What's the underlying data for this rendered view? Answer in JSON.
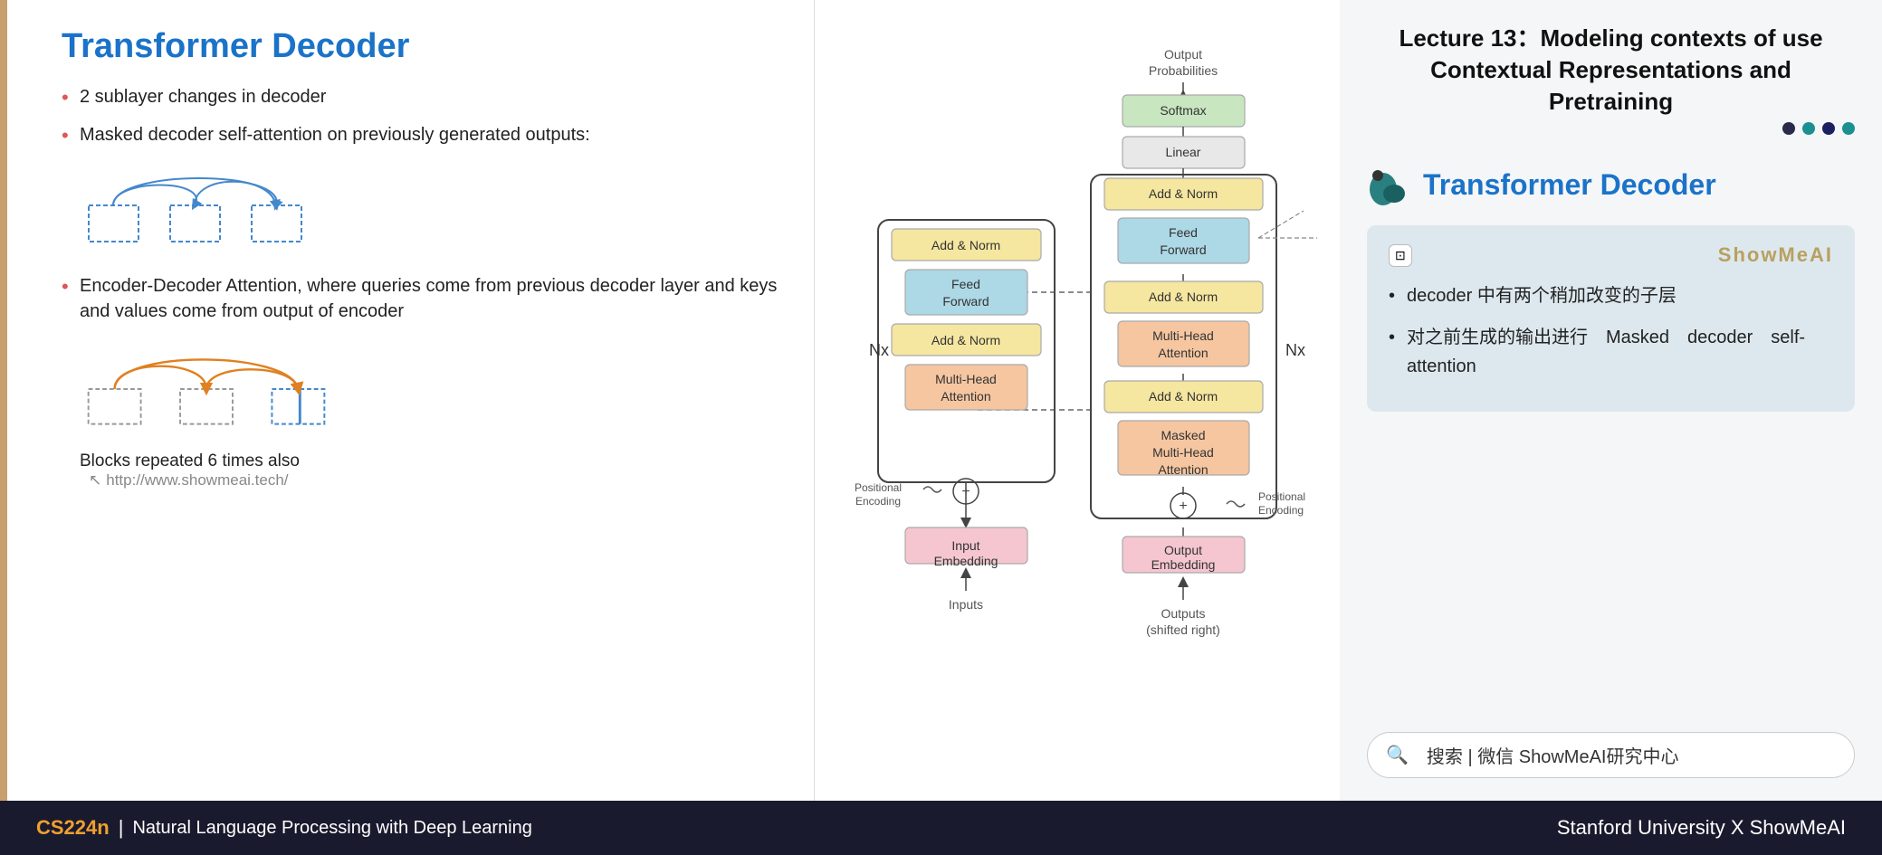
{
  "slide": {
    "title": "Transformer Decoder",
    "bullets": [
      "2 sublayer changes in decoder",
      "Masked decoder self-attention on previously generated outputs:",
      "Encoder-Decoder Attention, where queries come from previous decoder layer and keys and values come from output of encoder"
    ],
    "blocks_text": "Blocks repeated 6 times also",
    "url": "http://www.showmeai.tech/"
  },
  "right_panel": {
    "lecture_title": "Lecture 13：Modeling contexts of use Contextual\nRepresentations and Pretraining",
    "section_title": "Transformer Decoder",
    "ai_label": "ShowMeAI",
    "info_bullets": [
      "decoder 中有两个稍加改变的子层",
      "对之前生成的输出进行　Masked　decoder　self-attention"
    ],
    "search_text": "搜索 | 微信 ShowMeAI研究中心"
  },
  "bottom_bar": {
    "course_name": "CS224n",
    "separator": "|",
    "course_desc": "Natural Language Processing with Deep Learning",
    "right_text": "Stanford University X ShowMeAI"
  },
  "diagram": {
    "softmax": "Softmax",
    "output_prob": "Output\nProbabilities",
    "linear": "Linear",
    "add_norm1": "Add & Norm",
    "feed_forward1": "Feed\nForward",
    "add_norm2": "Add & Norm",
    "multi_head1": "Multi-Head\nAttention",
    "add_norm3": "Add & Norm",
    "masked_multi": "Masked\nMulti-Head\nAttention",
    "add_norm4": "Add & Norm",
    "feed_forward2": "Feed\nForward",
    "add_norm5": "Add & Norm",
    "multi_head2": "Multi-Head\nAttention",
    "nx_left": "Nx",
    "nx_right": "Nx",
    "positional_enc_left": "Positional\nEncoding",
    "positional_enc_right": "Positional\nEncoding",
    "input_emb": "Input\nEmbedding",
    "output_emb": "Output\nEmbedding",
    "inputs": "Inputs",
    "outputs": "Outputs\n(shifted right)"
  }
}
